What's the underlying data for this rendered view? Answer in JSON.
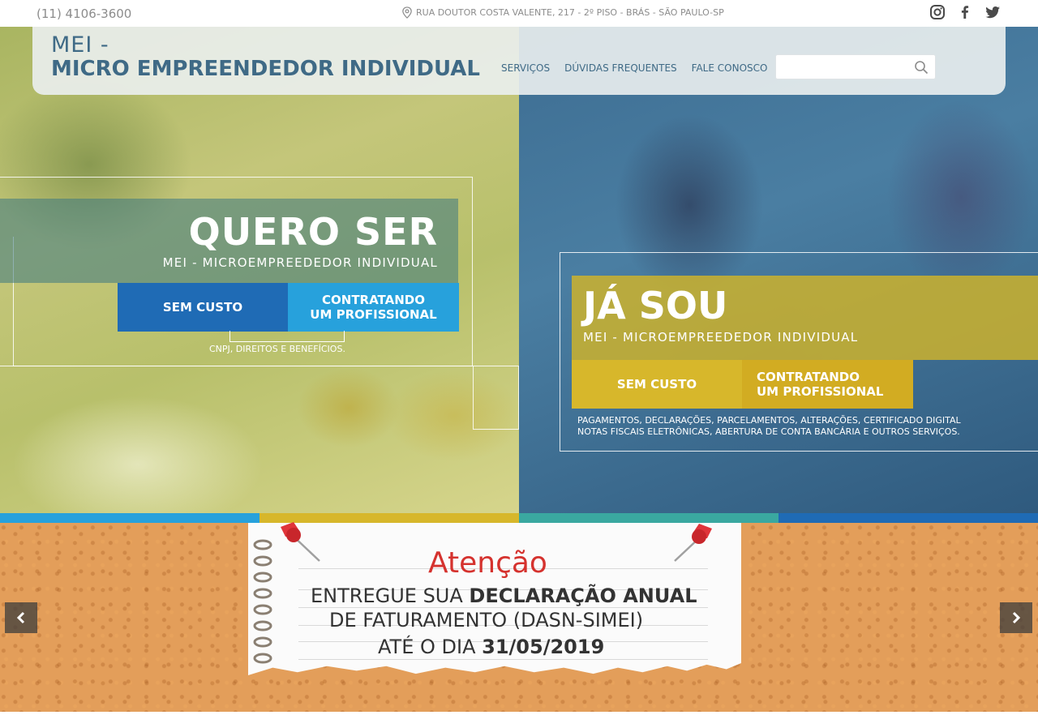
{
  "topbar": {
    "phone": "(11) 4106-3600",
    "address": "RUA DOUTOR COSTA VALENTE, 217 -  2º PISO - BRÁS - SÃO PAULO-SP",
    "social_icons": [
      "instagram-icon",
      "facebook-icon",
      "twitter-icon"
    ]
  },
  "header": {
    "logo_line1": "MEI -",
    "logo_line2": "MICRO EMPREENDEDOR INDIVIDUAL",
    "nav": [
      "SERVIÇOS",
      "DÚVIDAS FREQUENTES",
      "FALE CONOSCO"
    ],
    "search_placeholder": ""
  },
  "hero": {
    "left": {
      "title": "QUERO SER",
      "subtitle": "MEI - MICROEMPREEDEDOR INDIVIDUAL",
      "button_free": "SEM CUSTO",
      "button_pro_line1": "CONTRATANDO",
      "button_pro_line2": "UM PROFISSIONAL",
      "note": "CNPJ, DIREITOS E BENEFÍCIOS."
    },
    "right": {
      "title": "JÁ SOU",
      "subtitle": "MEI - MICROEMPREEDEDOR INDIVIDUAL",
      "button_free": "SEM CUSTO",
      "button_pro_line1": "CONTRATANDO",
      "button_pro_line2": "UM PROFISSIONAL",
      "note_line1": "PAGAMENTOS, DECLARAÇÕES, PARCELAMENTOS, ALTERAÇÕES, CERTIFICADO DIGITAL",
      "note_line2": "NOTAS FISCAIS ELETRÔNICAS, ABERTURA DE CONTA BANCÁRIA E OUTROS SERVIÇOS."
    }
  },
  "colors": {
    "brand_blue": "#3f6a86",
    "stripe": [
      "#27a1dc",
      "#d7b72b",
      "#3aa8a0",
      "#1f6bb5"
    ],
    "alert_red": "#d5322e"
  },
  "banner": {
    "title": "Atenção",
    "line1_a": "ENTREGUE SUA ",
    "line1_b": "DECLARAÇÃO ANUAL",
    "line2": "DE FATURAMENTO (DASN-SIMEI)",
    "line3_a": "ATÉ O DIA ",
    "line3_b": "31/05/2019",
    "prev_icon": "chevron-left-icon",
    "next_icon": "chevron-right-icon"
  }
}
